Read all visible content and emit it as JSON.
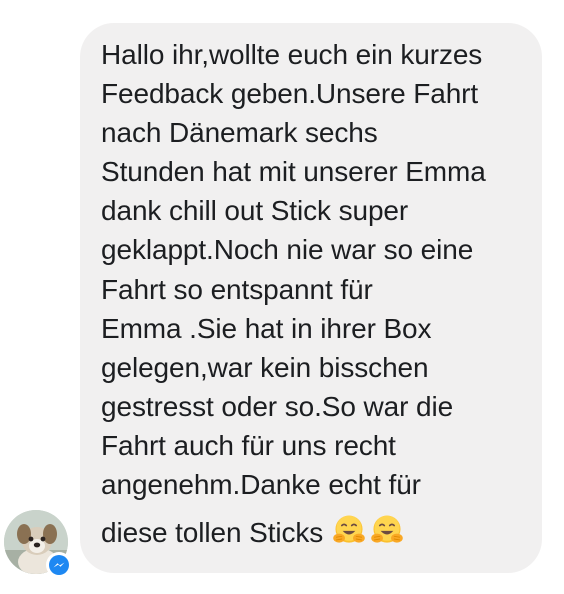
{
  "message": {
    "lines": [
      "Hallo ihr,wollte euch ein kurzes",
      "Feedback geben.Unsere Fahrt",
      "nach Dänemark sechs",
      "Stunden hat mit unserer Emma",
      "dank chill out Stick super",
      "geklappt.Noch nie war so eine",
      "Fahrt so entspannt für",
      "Emma .Sie hat in ihrer Box",
      "gelegen,war kein bisschen",
      "gestresst oder so.So war die",
      "Fahrt auch für uns recht",
      "angenehm.Danke echt für",
      "diese tollen Sticks"
    ],
    "emojis": [
      "hugging-face",
      "hugging-face"
    ]
  },
  "sender": {
    "avatar_icon": "dog-avatar",
    "badge_icon": "messenger-icon"
  },
  "colors": {
    "bubble": "#f1f0f0",
    "text": "#1c1e21",
    "messenger_blue": "#1e88f2"
  }
}
